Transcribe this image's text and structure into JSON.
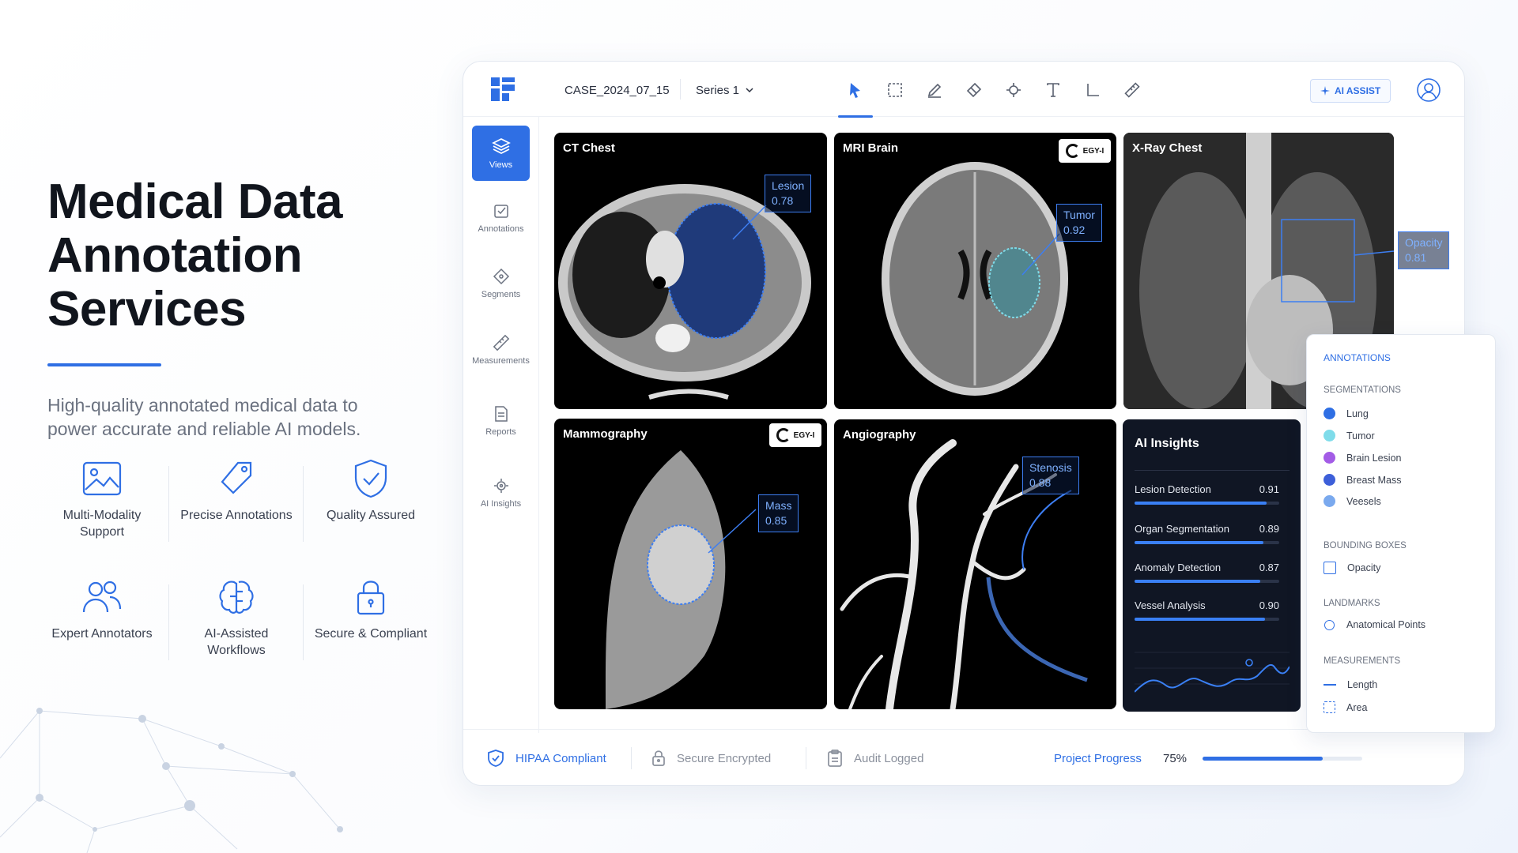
{
  "hero": {
    "title_line1": "Medical Data",
    "title_line2": "Annotation Services",
    "subtitle": "High-quality annotated medical data to power accurate and reliable AI models."
  },
  "features": [
    {
      "label": "Multi-Modality Support",
      "icon": "image-icon"
    },
    {
      "label": "Precise Annotations",
      "icon": "tag-icon"
    },
    {
      "label": "Quality Assured",
      "icon": "shield-check-icon"
    },
    {
      "label": "Expert Annotators",
      "icon": "users-icon"
    },
    {
      "label": "AI-Assisted Workflows",
      "icon": "brain-icon"
    },
    {
      "label": "Secure & Compliant",
      "icon": "lock-icon"
    }
  ],
  "topbar": {
    "case_id": "CASE_2024_07_15",
    "series": "Series 1",
    "tools": [
      "pointer-icon",
      "rectangle-icon",
      "pen-icon",
      "eraser-icon",
      "keypoint-icon",
      "text-icon",
      "angle-icon",
      "ruler-icon"
    ],
    "ai_assist": "AI ASSIST"
  },
  "sidebar": {
    "items": [
      {
        "label": "Views",
        "icon": "layers-icon",
        "active": true
      },
      {
        "label": "Annotations",
        "icon": "annotation-icon"
      },
      {
        "label": "Segments",
        "icon": "segment-icon"
      },
      {
        "label": "Measurements",
        "icon": "ruler-icon"
      },
      {
        "label": "Reports",
        "icon": "report-icon"
      },
      {
        "label": "AI Insights",
        "icon": "ai-icon"
      }
    ]
  },
  "tiles": {
    "ct": {
      "title": "CT Chest",
      "callout_label": "Lesion",
      "callout_value": "0.78"
    },
    "mri": {
      "title": "MRI Brain",
      "callout_label": "Tumor",
      "callout_value": "0.92",
      "badge": "EGY-I"
    },
    "xray": {
      "title": "X-Ray Chest",
      "callout_label": "Opacity",
      "callout_value": "0.81"
    },
    "mammo": {
      "title": "Mammography",
      "callout_label": "Mass",
      "callout_value": "0.85",
      "badge": "EGY-I"
    },
    "angio": {
      "title": "Angiography",
      "callout_label": "Stenosis",
      "callout_value": "0.88"
    }
  },
  "insights": {
    "title": "AI Insights",
    "metrics": [
      {
        "label": "Lesion Detection",
        "value": "0.91",
        "fraction": 0.91
      },
      {
        "label": "Organ Segmentation",
        "value": "0.89",
        "fraction": 0.89
      },
      {
        "label": "Anomaly Detection",
        "value": "0.87",
        "fraction": 0.87
      },
      {
        "label": "Vessel Analysis",
        "value": "0.90",
        "fraction": 0.9
      }
    ]
  },
  "legend": {
    "title": "ANNOTATIONS",
    "segmentations_title": "SEGMENTATIONS",
    "segmentations": [
      {
        "label": "Lung",
        "color": "#2f6fe4"
      },
      {
        "label": "Tumor",
        "color": "#7fdcea"
      },
      {
        "label": "Brain Lesion",
        "color": "#a35ce6"
      },
      {
        "label": "Breast Mass",
        "color": "#3d5fd9"
      },
      {
        "label": "Veesels",
        "color": "#7aa9ee"
      }
    ],
    "bounding_title": "BOUNDING BOXES",
    "bounding": "Opacity",
    "landmarks_title": "LANDMARKS",
    "landmarks": "Anatomical Points",
    "measurements_title": "MEASUREMENTS",
    "measure_length": "Length",
    "measure_area": "Area"
  },
  "footer": {
    "hipaa": "HIPAA Compliant",
    "encrypted": "Secure Encrypted",
    "audit": "Audit Logged",
    "progress_label": "Project Progress",
    "progress_value": "75%",
    "progress_fraction": 0.75
  },
  "colors": {
    "accent": "#2f6fe4",
    "dark_panel": "#101624"
  }
}
